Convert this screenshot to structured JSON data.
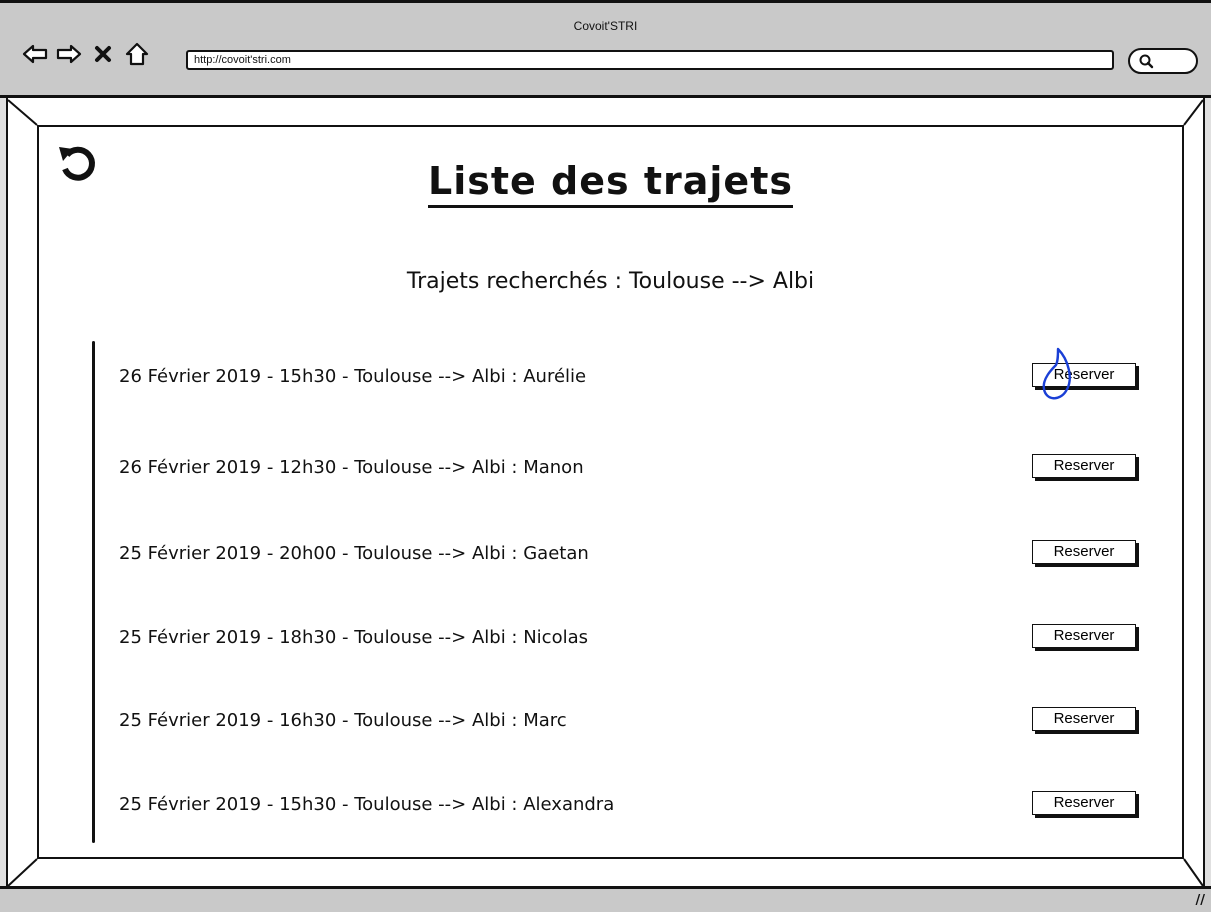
{
  "window": {
    "title": "Covoit'STRI",
    "url": "http://covoit'stri.com"
  },
  "nav": {
    "icons": [
      "back-arrow-icon",
      "forward-arrow-icon",
      "close-x-icon",
      "home-icon"
    ],
    "search_icon": "search-icon"
  },
  "page": {
    "title": "Liste des trajets",
    "search_summary": "Trajets recherchés : Toulouse --> Albi",
    "refresh_icon": "refresh-icon"
  },
  "trips": [
    {
      "label": "26 Février 2019 - 15h30 - Toulouse --> Albi : Aurélie",
      "button": "Reserver"
    },
    {
      "label": "26 Février 2019 - 12h30 - Toulouse --> Albi : Manon",
      "button": "Reserver"
    },
    {
      "label": "25 Février 2019 - 20h00 - Toulouse --> Albi : Gaetan",
      "button": "Reserver"
    },
    {
      "label": "25 Février 2019 - 18h30 - Toulouse --> Albi : Nicolas",
      "button": "Reserver"
    },
    {
      "label": "25 Février 2019 - 16h30 - Toulouse --> Albi : Marc",
      "button": "Reserver"
    },
    {
      "label": "25 Février 2019 - 15h30 - Toulouse --> Albi : Alexandra",
      "button": "Reserver"
    }
  ],
  "colors": {
    "chrome": "#c9c9c9",
    "ink": "#111111",
    "cursor": "#1a3fd6"
  }
}
